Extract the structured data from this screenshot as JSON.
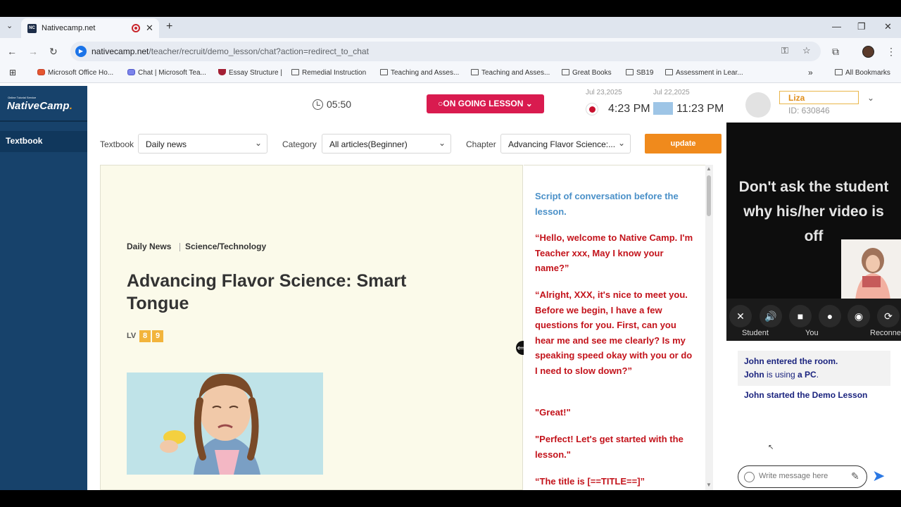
{
  "browser": {
    "tab_title": "Nativecamp.net",
    "tab_favicon": "NC",
    "url_host": "nativecamp.net",
    "url_path": "/teacher/recruit/demo_lesson/chat?action=redirect_to_chat",
    "bookmarks": [
      "Microsoft Office Ho...",
      "Chat | Microsoft Tea...",
      "Essay Structure |",
      "Remedial Instruction",
      "Teaching and Asses...",
      "Teaching and Asses...",
      "Great Books",
      "SB19",
      "Assessment in Lear..."
    ],
    "all_bookmarks": "All Bookmarks"
  },
  "sidebar": {
    "logo_small": "Online Tutorial Service",
    "logo": "NativeCamp",
    "logo_dot": ".",
    "items": [
      {
        "label": "Textbook"
      }
    ]
  },
  "header": {
    "timer": "05:50",
    "lesson_status": "ON GOING LESSON",
    "local_date": "Jul 23,2025",
    "local_time": "4:23 PM",
    "other_date": "Jul 22,2025",
    "other_time": "11:23 PM",
    "tutor_name": "Liza",
    "tutor_id": "ID: 630846"
  },
  "controls": {
    "textbook_label": "Textbook",
    "textbook_value": "Daily news",
    "category_label": "Category",
    "category_value": "All articles(Beginner)",
    "chapter_label": "Chapter",
    "chapter_value": "Advancing Flavor Science:...",
    "update_label": "update"
  },
  "article": {
    "category1": "Daily News",
    "category2": "Science/Technology",
    "title": "Advancing Flavor Science: Smart Tongue",
    "level_label": "LV",
    "levels": [
      "8",
      "9"
    ]
  },
  "script": {
    "heading": "Script of conversation before the lesson.",
    "paragraphs": [
      "“Hello, welcome to Native Camp. I'm Teacher xxx, May I know your name?”",
      "“Alright, XXX, it's nice to meet you. Before we begin, I have a few questions for you. First, can you hear me and see me clearly? Is my speaking speed okay with you or do I need to slow down?”",
      "\"Great!\"",
      "\"Perfect! Let's get started with the lesson.\"",
      "“The title is [==TITLE==]”"
    ]
  },
  "video": {
    "message": "Don't ask the student why his/her video is off",
    "labels": {
      "student": "Student",
      "you": "You",
      "reconnect": "Reconne"
    }
  },
  "chat": {
    "msg1_name": "John",
    "msg1_text": " entered the room.",
    "msg1b_name": "John",
    "msg1b_mid": " is using ",
    "msg1b_device": "a PC",
    "msg1b_end": ".",
    "msg2": "John started the Demo Lesson",
    "input_placeholder": "Write message here"
  },
  "colors": {
    "sidebar": "#17426b",
    "accent_orange": "#f08a1c",
    "ongoing_red": "#d91b4f",
    "script_red": "#c3131b",
    "script_blue": "#4a90c8",
    "article_bg": "#fbfaea"
  }
}
